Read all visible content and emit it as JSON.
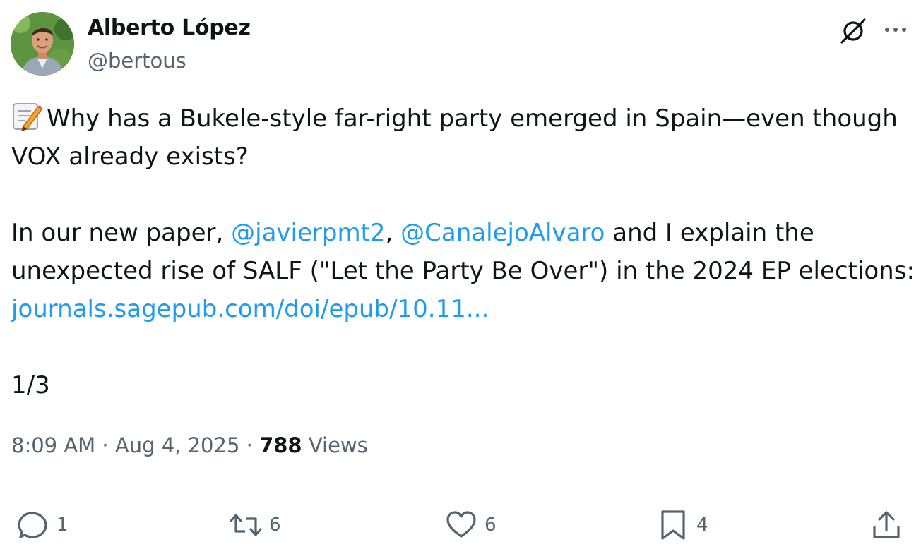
{
  "author": {
    "name": "Alberto López",
    "handle": "@bertous"
  },
  "post": {
    "emoji": "memo-icon",
    "line1": "Why has a Bukele-style far-right party emerged in Spain—even though",
    "line2": "VOX already exists?",
    "para2_prefix": "In our new paper, ",
    "mention1": "@javierpmt2",
    "sep": ", ",
    "mention2": "@CanalejoAlvaro",
    "para2_suffix": " and I explain the",
    "line4": "unexpected rise of SALF (\"Let the Party Be Over\") in the 2024 EP elections:",
    "link": "journals.sagepub.com/doi/epub/10.11...",
    "thread_counter": "1/3"
  },
  "meta": {
    "time": "8:09 AM",
    "dot1": " · ",
    "date": "Aug 4, 2025",
    "dot2": " · ",
    "views_count": "788",
    "views_label": " Views"
  },
  "actions": {
    "replies": "1",
    "reposts": "6",
    "likes": "6",
    "bookmarks": "4"
  },
  "icons": {
    "grok": "grok-icon",
    "more": "more-horizontal-icon",
    "reply": "reply-icon",
    "repost": "repost-icon",
    "like": "heart-icon",
    "bookmark": "bookmark-icon",
    "share": "share-icon"
  },
  "colors": {
    "text": "#0f1419",
    "secondary": "#536471",
    "link": "#1d9bf0",
    "divider": "#e5e9ec"
  }
}
